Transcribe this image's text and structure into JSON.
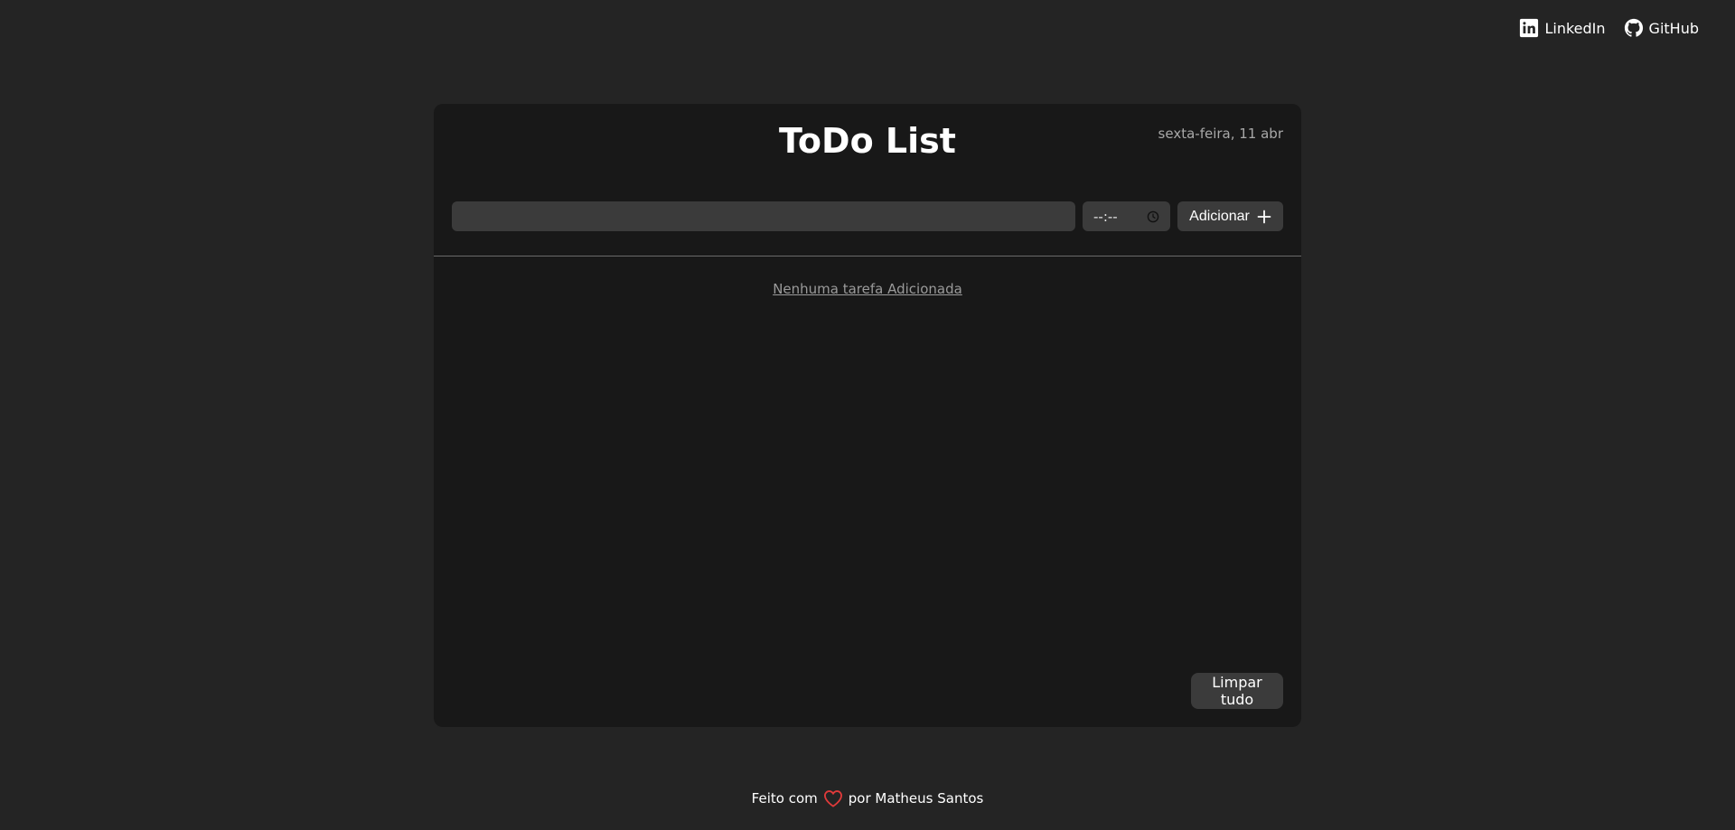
{
  "header": {
    "links": [
      {
        "label": "LinkedIn",
        "icon": "linkedin-icon"
      },
      {
        "label": "GitHub",
        "icon": "github-icon"
      }
    ]
  },
  "card": {
    "title": "ToDo List",
    "date": "sexta-feira, 11 abr",
    "task_input": {
      "value": "",
      "placeholder": ""
    },
    "time_input": {
      "display": "--:--",
      "icon": "clock-icon"
    },
    "add_button": {
      "label": "Adicionar",
      "icon": "plus-icon"
    },
    "empty_message": "Nenhuma tarefa Adicionada",
    "clear_button": {
      "label": "Limpar tudo"
    }
  },
  "footer": {
    "prefix": "Feito com",
    "icon": "heart-icon",
    "suffix": "por Matheus Santos"
  },
  "colors": {
    "background": "#242424",
    "card": "#181818",
    "control": "#3b3b3b",
    "heart": "#e03a3a"
  }
}
